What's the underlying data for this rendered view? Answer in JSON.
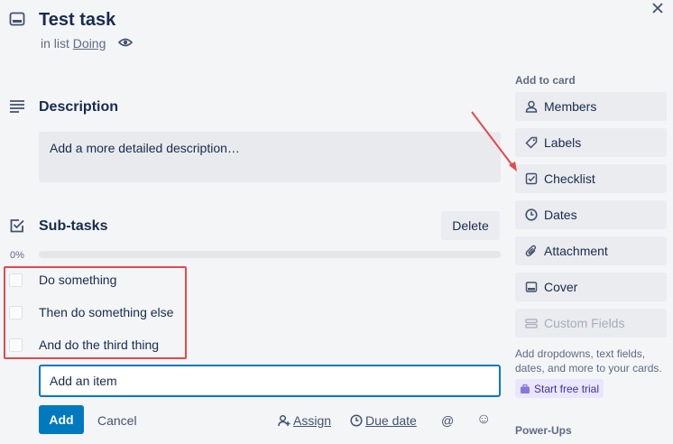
{
  "card": {
    "title": "Test task",
    "in_list_prefix": "in list",
    "list_name": "Doing"
  },
  "description": {
    "heading": "Description",
    "placeholder": "Add a more detailed description…"
  },
  "checklist": {
    "heading": "Sub-tasks",
    "delete_label": "Delete",
    "progress_label": "0%",
    "progress": 0,
    "items": [
      {
        "label": "Do something",
        "checked": false
      },
      {
        "label": "Then do something else",
        "checked": false
      },
      {
        "label": "And do the third thing",
        "checked": false
      }
    ],
    "add_item_placeholder": "Add an item",
    "add_label": "Add",
    "cancel_label": "Cancel",
    "assign_label": "Assign",
    "due_date_label": "Due date",
    "mention_symbol": "@",
    "emoji_symbol": "☺"
  },
  "sidebar": {
    "heading": "Add to card",
    "buttons": [
      {
        "label": "Members",
        "icon": "member-icon"
      },
      {
        "label": "Labels",
        "icon": "label-icon"
      },
      {
        "label": "Checklist",
        "icon": "checklist-icon"
      },
      {
        "label": "Dates",
        "icon": "clock-icon"
      },
      {
        "label": "Attachment",
        "icon": "paperclip-icon"
      },
      {
        "label": "Cover",
        "icon": "cover-icon"
      },
      {
        "label": "Custom Fields",
        "icon": "custom-fields-icon"
      }
    ],
    "custom_fields_note": "Add dropdowns, text fields, dates, and more to your cards.",
    "trial_label": "Start free trial",
    "powerups_heading": "Power-Ups"
  },
  "colors": {
    "accent": "#0079bf",
    "annotation": "#e34850"
  }
}
